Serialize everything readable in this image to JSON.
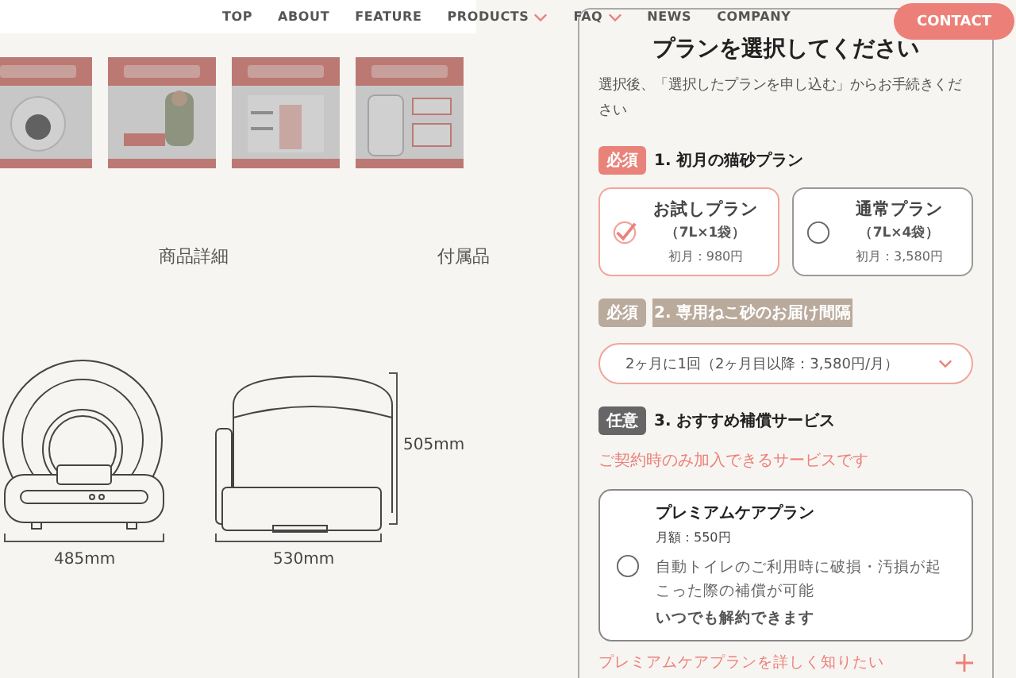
{
  "nav": {
    "items": [
      {
        "label": "TOP",
        "dropdown": false
      },
      {
        "label": "ABOUT",
        "dropdown": false
      },
      {
        "label": "FEATURE",
        "dropdown": false
      },
      {
        "label": "PRODUCTS",
        "dropdown": true
      },
      {
        "label": "FAQ",
        "dropdown": true
      },
      {
        "label": "NEWS",
        "dropdown": false
      },
      {
        "label": "COMPANY",
        "dropdown": false
      }
    ],
    "contact": "CONTACT"
  },
  "gallery": [
    {
      "kind": "picture"
    },
    {
      "kind": "picture"
    },
    {
      "kind": "picture"
    },
    {
      "kind": "picture"
    }
  ],
  "product_tabs": [
    "商品詳細",
    "付属品"
  ],
  "dimensions": {
    "front_width": "485mm",
    "side_width": "530mm",
    "height": "505mm"
  },
  "panel": {
    "title": "プランを選択してください",
    "subtitle": "選択後、「選択したプランを申し込む」からお手続きください",
    "sections": [
      {
        "badge": "必須",
        "kind": "required",
        "title": "1. 初月の猫砂プラン",
        "highlighted": false
      },
      {
        "badge": "必須",
        "kind": "required",
        "title": "2. 専用ねこ砂のお届け間隔",
        "highlighted": true
      },
      {
        "badge": "任意",
        "kind": "optional",
        "title": "3. おすすめ補償サービス",
        "highlighted": false
      }
    ],
    "plans": [
      {
        "name": "お試しプラン",
        "size": "（7L×1袋）",
        "price": "初月：980円",
        "selected": true
      },
      {
        "name": "通常プラン",
        "size": "（7L×4袋）",
        "price": "初月：3,580円",
        "selected": false
      }
    ],
    "interval": {
      "value": "2ヶ月に1回（2ヶ月目以降：3,580円/月）"
    },
    "service_note": "ご契約時のみ加入できるサービスです",
    "care_plan": {
      "name": "プレミアムケアプラン",
      "price": "月額：550円",
      "description": "自動トイレのご利用時に破損・汚損が起こった際の補償が可能",
      "cancel_note": "いつでも解約できます",
      "selected": false
    },
    "more_link": "プレミアムケアプランを詳しく知りたい"
  }
}
